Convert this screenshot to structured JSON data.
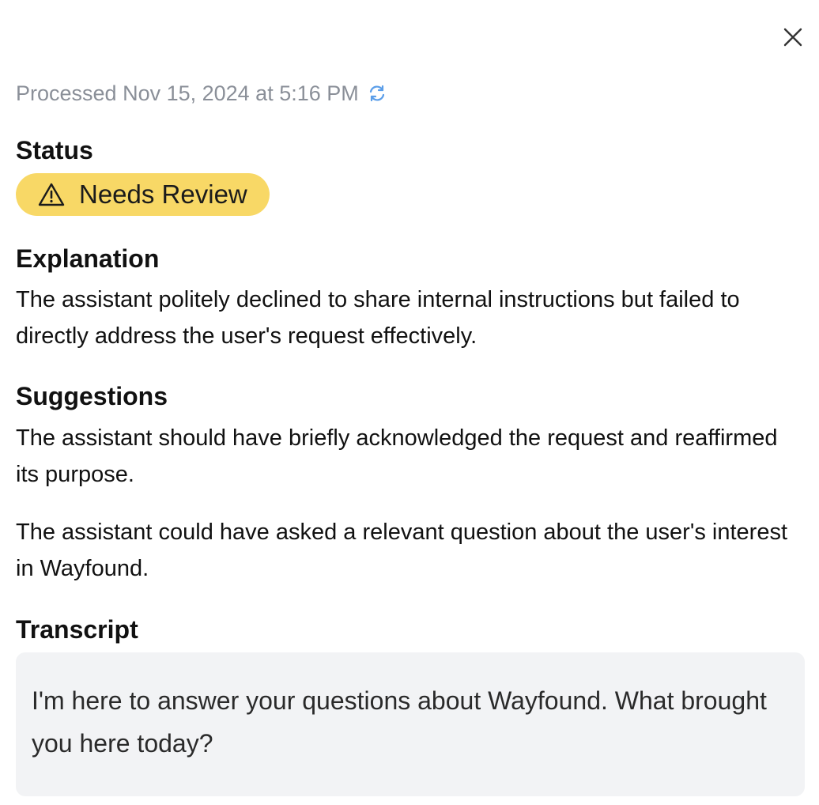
{
  "processed": {
    "text": "Processed Nov 15, 2024 at 5:16 PM",
    "refresh_icon": "refresh-icon",
    "refresh_color": "#5b9ee9"
  },
  "close_icon": "close-icon",
  "status": {
    "heading": "Status",
    "badge_label": "Needs Review",
    "badge_icon": "warning-triangle-icon",
    "badge_color": "#f8d866"
  },
  "explanation": {
    "heading": "Explanation",
    "text": "The assistant politely declined to share internal instructions but failed to directly address the user's request effectively."
  },
  "suggestions": {
    "heading": "Suggestions",
    "items": [
      "The assistant should have briefly acknowledged the request and reaffirmed its purpose.",
      "The assistant could have asked a relevant question about the user's interest in Wayfound."
    ]
  },
  "transcript": {
    "heading": "Transcript",
    "message": "I'm here to answer your questions about Wayfound. What brought you here today?"
  }
}
